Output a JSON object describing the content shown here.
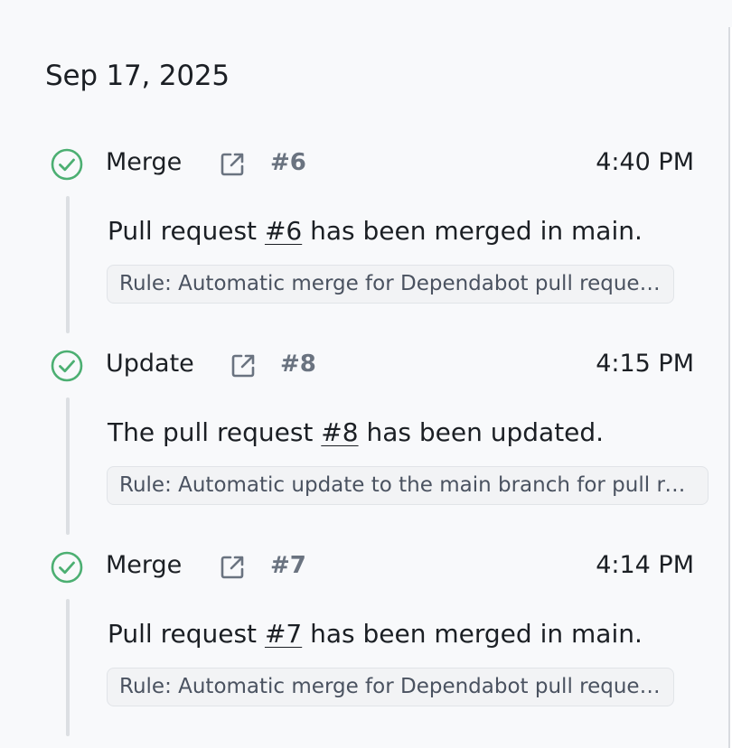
{
  "date": "Sep 17, 2025",
  "colors": {
    "success": "#4caf72",
    "muted": "#6a7380",
    "line": "#dcdfe3"
  },
  "events": [
    {
      "type": "Merge",
      "icon": "check-circle-icon",
      "pr_number": "#6",
      "time": "4:40 PM",
      "description": {
        "before": "Pull request ",
        "link": "#6",
        "after": " has been merged in main."
      },
      "rule": "Rule: Automatic merge for Dependabot pull requests"
    },
    {
      "type": "Update",
      "icon": "check-circle-icon",
      "pr_number": "#8",
      "time": "4:15 PM",
      "description": {
        "before": "The pull request ",
        "link": "#8",
        "after": " has been updated."
      },
      "rule": "Rule: Automatic update to the main branch for pull re..."
    },
    {
      "type": "Merge",
      "icon": "check-circle-icon",
      "pr_number": "#7",
      "time": "4:14 PM",
      "description": {
        "before": "Pull request ",
        "link": "#7",
        "after": " has been merged in main."
      },
      "rule": "Rule: Automatic merge for Dependabot pull requests"
    }
  ]
}
